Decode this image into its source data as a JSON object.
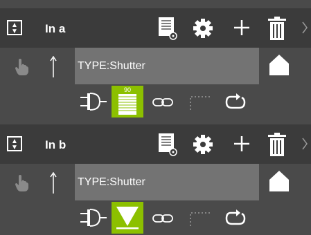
{
  "units": [
    {
      "name": "In a",
      "type_label": "TYPE:Shutter",
      "position_value": "90",
      "state_icon": "shutter-closed-icon"
    },
    {
      "name": "In b",
      "type_label": "TYPE:Shutter",
      "position_value": "",
      "state_icon": "shutter-down-arrow-icon"
    }
  ],
  "icons": {
    "selector": "updown-selector-icon",
    "document": "document-icon",
    "settings": "gear-icon",
    "add": "plus-icon",
    "delete": "trash-icon",
    "expand": "chevron-right-icon",
    "touch": "touch-hand-icon",
    "direction": "arrow-up-icon",
    "home": "home-icon",
    "actuator": "actuator-icon",
    "link": "link-icon",
    "dashed": "dashed-connector-icon",
    "refresh": "refresh-icon"
  },
  "colors": {
    "header_bg": "#3b3b3b",
    "row_bg": "#4a4a4a",
    "type_box": "#737373",
    "accent": "#8cc000"
  }
}
